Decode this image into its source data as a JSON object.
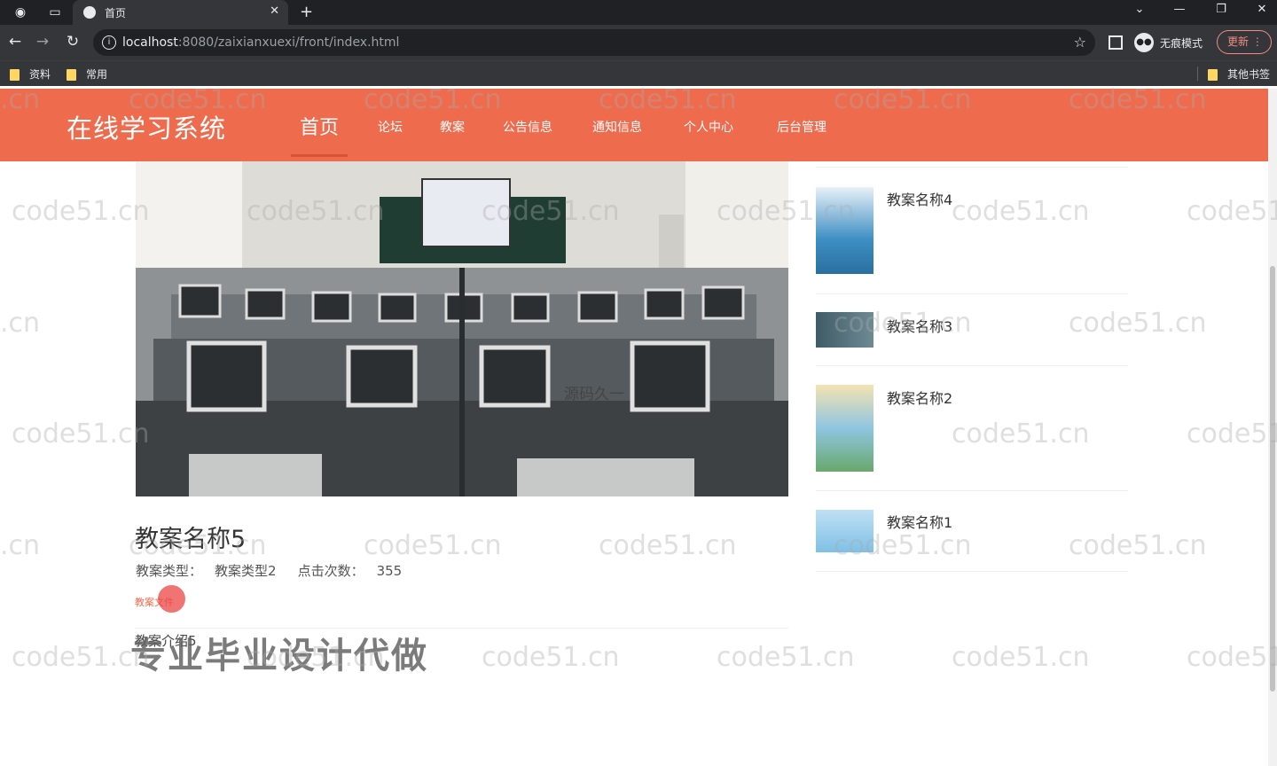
{
  "browser": {
    "tab_title": "首页",
    "url_host": "localhost",
    "url_rest": ":8080/zaixianxuexi/front/index.html",
    "incognito_label": "无痕模式",
    "update_label": "更新",
    "bookmarks": [
      "资料",
      "常用"
    ],
    "other_bookmarks": "其他书签"
  },
  "site": {
    "logo": "在线学习系统",
    "nav": [
      "首页",
      "论坛",
      "教案",
      "公告信息",
      "通知信息",
      "个人中心",
      "后台管理"
    ],
    "active_nav": "首页"
  },
  "detail": {
    "title": "教案名称5",
    "type_label": "教案类型：",
    "type_value": "教案类型2",
    "clicks_label": "点击次数：",
    "clicks_value": "355",
    "file_link": "教案文件",
    "intro": "教案介绍5"
  },
  "related": [
    {
      "title": "教案名称4"
    },
    {
      "title": "教案名称3"
    },
    {
      "title": "教案名称2"
    },
    {
      "title": "教案名称1"
    }
  ],
  "watermark": "code51.cn",
  "watermark_short": ".cn",
  "overlay_text": "专业毕业设计代做",
  "center_text": "源码久一"
}
